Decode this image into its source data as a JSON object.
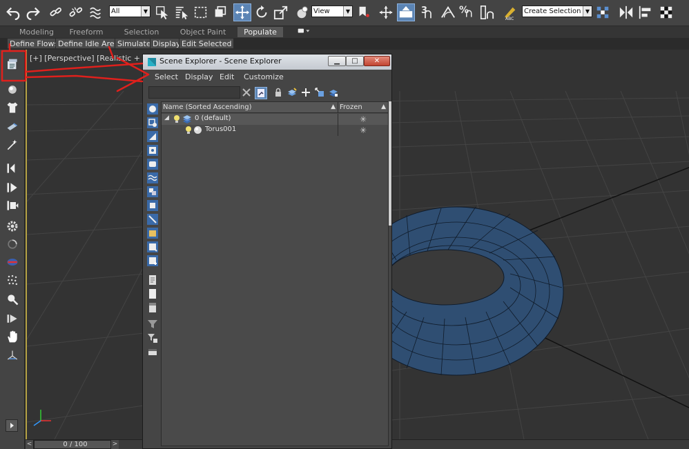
{
  "toolbar": {
    "selection_filter": "All",
    "reference_coordinate": "View",
    "named_selection": "Create Selection Se",
    "abc_label": "ABC",
    "snap_3": "3",
    "percent_snap": "%"
  },
  "ribbon": {
    "tabs": [
      "Modeling",
      "Freeform",
      "Selection",
      "Object Paint",
      "Populate"
    ],
    "active_tab": "Populate",
    "sub_tabs": [
      "Define Flows",
      "Define Idle Areas",
      "Simulate",
      "Display",
      "Edit Selected"
    ]
  },
  "viewport": {
    "label": "[+] [Perspective] [Realistic + Edged ]"
  },
  "time_slider": {
    "frame_display": "0 / 100",
    "left_arrow": "<",
    "right_arrow": ">"
  },
  "scene_explorer": {
    "title": "Scene Explorer - Scene Explorer",
    "menus": [
      "Select",
      "Display",
      "Edit",
      "Customize"
    ],
    "search_value": "",
    "columns": {
      "name": "Name (Sorted Ascending)",
      "frozen": "Frozen"
    },
    "rows": [
      {
        "label": "0 (default)",
        "frozen": "✳",
        "level": 0
      },
      {
        "label": "Torus001",
        "frozen": "✳",
        "level": 1
      }
    ],
    "window_buttons": {
      "minimize": "▁",
      "maximize": "□",
      "close": "✕"
    }
  },
  "colors": {
    "annotation_red": "#e0201c",
    "active_blue": "#5b84b4",
    "torus": "#2f4e72"
  },
  "icons": [
    "undo-icon",
    "redo-icon",
    "link-icon",
    "unlink-icon",
    "bind-spacewarp-icon",
    "select-object-icon",
    "select-by-name-icon",
    "rect-region-icon",
    "window-crossing-icon",
    "move-icon",
    "rotate-icon",
    "scale-icon",
    "place-icon",
    "pivot-icon",
    "manipulate-icon",
    "keyboard-shortcut-icon",
    "snap-icon",
    "angle-snap-icon",
    "percent-snap-icon",
    "spinner-snap-icon",
    "edit-named-sel-icon",
    "mirror-icon",
    "align-icon",
    "scene-explorer-icon"
  ]
}
